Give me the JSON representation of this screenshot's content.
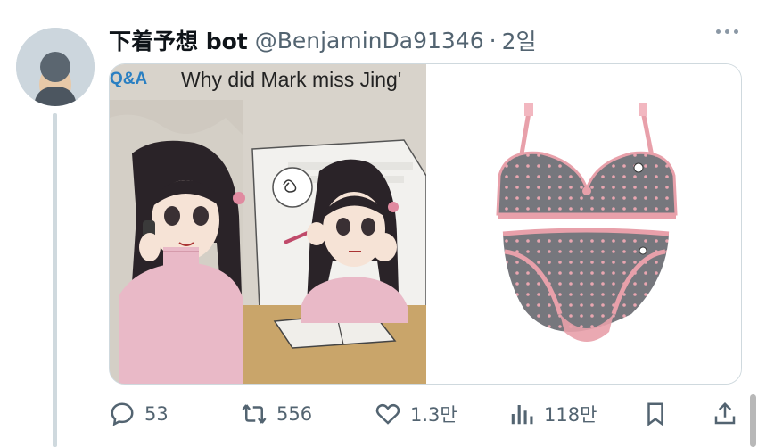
{
  "tweet": {
    "display_name": "下着予想 bot",
    "handle": "@BenjaminDa91346",
    "separator": "·",
    "time": "2일",
    "avatar_icon": "default-profile-icon",
    "more_icon": "more-dots-icon"
  },
  "media": {
    "left_image": {
      "qa_label": "Q&A",
      "question_text": "Why did Mark miss Jing'"
    },
    "right_image": {
      "subject": "gray polka-dot bra and panty set with pink trim"
    }
  },
  "actions": {
    "reply": {
      "icon": "reply-icon",
      "count": "53"
    },
    "repost": {
      "icon": "repost-icon",
      "count": "556"
    },
    "like": {
      "icon": "heart-icon",
      "count": "1.3만"
    },
    "views": {
      "icon": "views-icon",
      "count": "118만"
    },
    "bookmark": {
      "icon": "bookmark-icon"
    },
    "share": {
      "icon": "share-icon"
    }
  },
  "colors": {
    "text_primary": "#0f1419",
    "text_secondary": "#536471",
    "border": "#cfd9de",
    "qa_blue": "#2a7fc2",
    "bra_gray": "#7a7a80",
    "trim_pink": "#e8a0aa"
  }
}
